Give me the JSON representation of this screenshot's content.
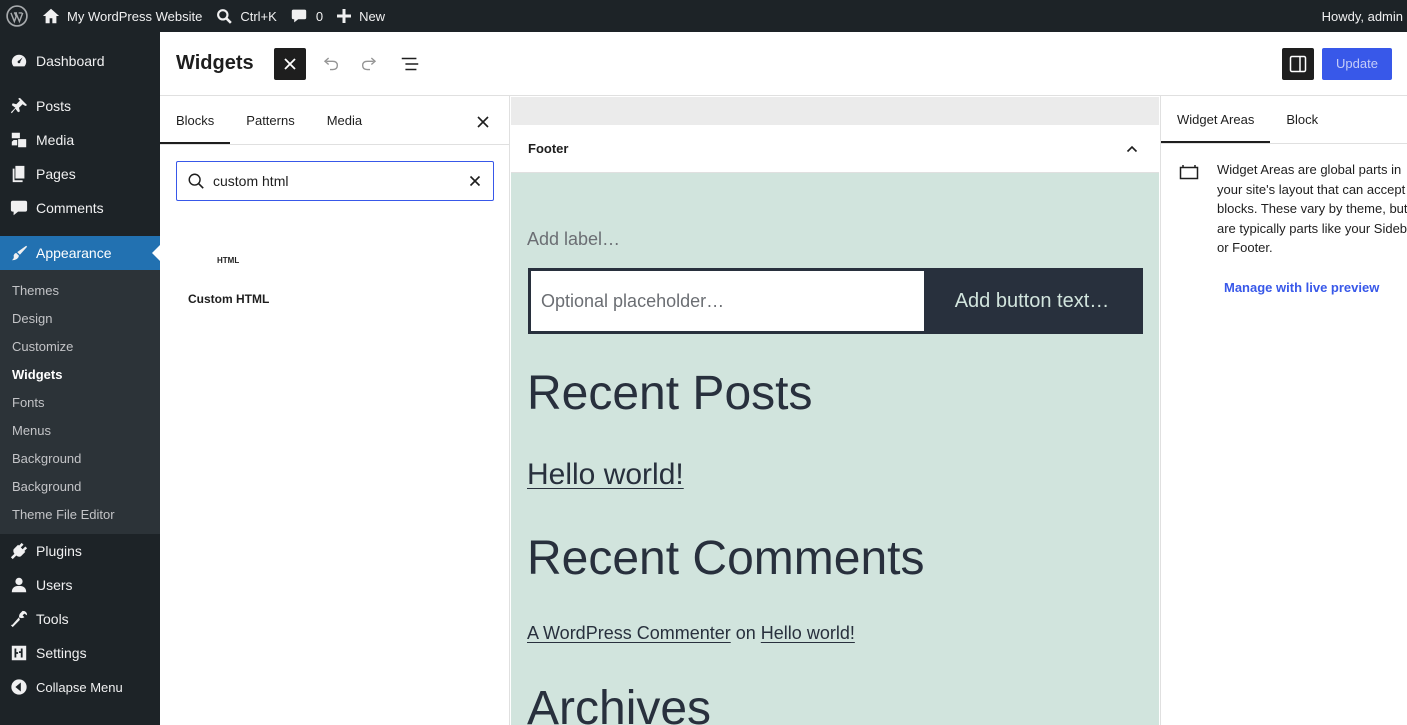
{
  "admin_bar": {
    "site_name": "My WordPress Website",
    "search_shortcut": "Ctrl+K",
    "comments_count": "0",
    "new_label": "New",
    "howdy": "Howdy, admin"
  },
  "admin_menu": {
    "dashboard": "Dashboard",
    "posts": "Posts",
    "media": "Media",
    "pages": "Pages",
    "comments": "Comments",
    "appearance": "Appearance",
    "submenu": [
      "Themes",
      "Design",
      "Customize",
      "Widgets",
      "Fonts",
      "Menus",
      "Background",
      "Background",
      "Theme File Editor"
    ],
    "plugins": "Plugins",
    "users": "Users",
    "tools": "Tools",
    "settings": "Settings",
    "collapse": "Collapse Menu"
  },
  "editor_header": {
    "title": "Widgets",
    "update_label": "Update"
  },
  "inserter": {
    "tabs": [
      "Blocks",
      "Patterns",
      "Media"
    ],
    "search_value": "custom html",
    "result_icon_text": "HTML",
    "result_label": "Custom HTML"
  },
  "canvas": {
    "area_title": "Footer",
    "add_label": "Add label…",
    "search_placeholder": "Optional placeholder…",
    "button_text": "Add button text…",
    "recent_posts": "Recent Posts",
    "hello_world": "Hello world!",
    "recent_comments": "Recent Comments",
    "commenter": "A WordPress Commenter",
    "on_word": "on",
    "comment_post": "Hello world!",
    "archives": "Archives"
  },
  "sidebar": {
    "tabs": [
      "Widget Areas",
      "Block"
    ],
    "description": "Widget Areas are global parts in your site's layout that can accept blocks. These vary by theme, but are typically parts like your Sidebar or Footer.",
    "manage_link": "Manage with live preview"
  },
  "colors": {
    "admin_dark": "#1d2327",
    "admin_blue": "#2271b1",
    "accent": "#3858e9",
    "canvas_bg": "#d1e4dd",
    "canvas_text": "#28303d"
  }
}
